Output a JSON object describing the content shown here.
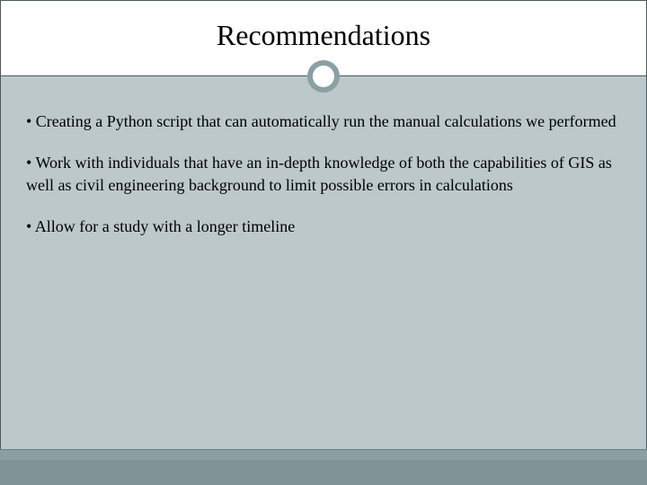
{
  "title": "Recommendations",
  "bullets": {
    "b1": "• Creating a Python script that can automatically run the manual calculations we performed",
    "b2": "• Work with individuals that have an in-depth knowledge of both the capabilities of GIS as well as civil engineering background to limit possible errors in calculations",
    "b3": "• Allow for a study with a longer timeline"
  }
}
